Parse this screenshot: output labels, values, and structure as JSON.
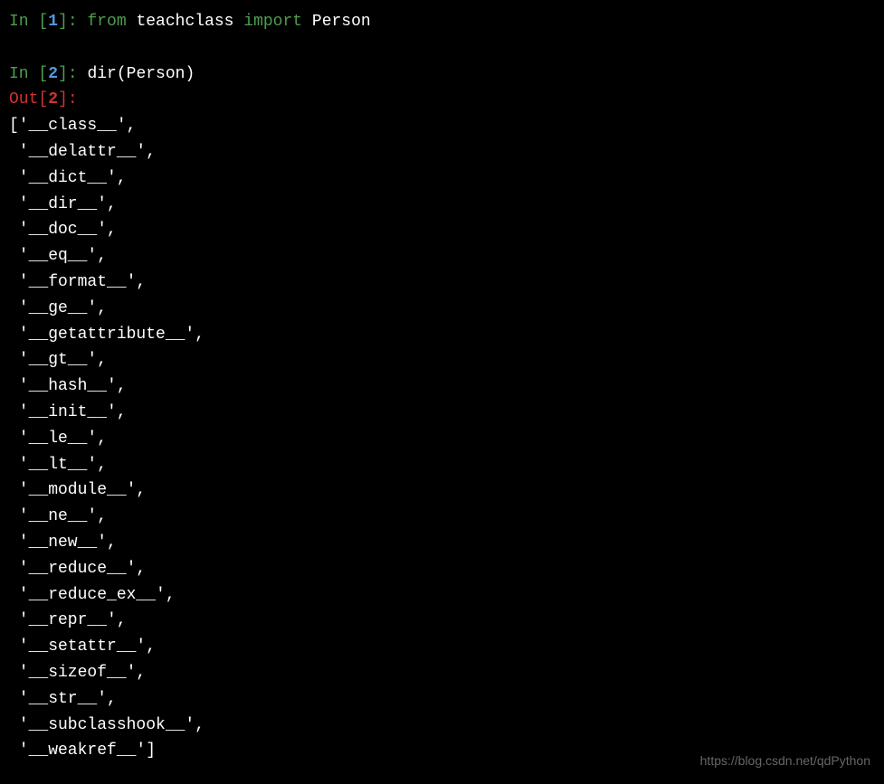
{
  "cells": [
    {
      "in_label": "In [",
      "in_number": "1",
      "in_close": "]: ",
      "code_parts": {
        "from": "from",
        "module": " teachclass ",
        "import": "import",
        "name": " Person"
      }
    },
    {
      "in_label": "In [",
      "in_number": "2",
      "in_close": "]: ",
      "code": "dir(Person)",
      "out_label": "Out[",
      "out_number": "2",
      "out_close": "]:",
      "output_lines": [
        "['__class__',",
        " '__delattr__',",
        " '__dict__',",
        " '__dir__',",
        " '__doc__',",
        " '__eq__',",
        " '__format__',",
        " '__ge__',",
        " '__getattribute__',",
        " '__gt__',",
        " '__hash__',",
        " '__init__',",
        " '__le__',",
        " '__lt__',",
        " '__module__',",
        " '__ne__',",
        " '__new__',",
        " '__reduce__',",
        " '__reduce_ex__',",
        " '__repr__',",
        " '__setattr__',",
        " '__sizeof__',",
        " '__str__',",
        " '__subclasshook__',",
        " '__weakref__']"
      ]
    }
  ],
  "watermark": "https://blog.csdn.net/qdPython"
}
